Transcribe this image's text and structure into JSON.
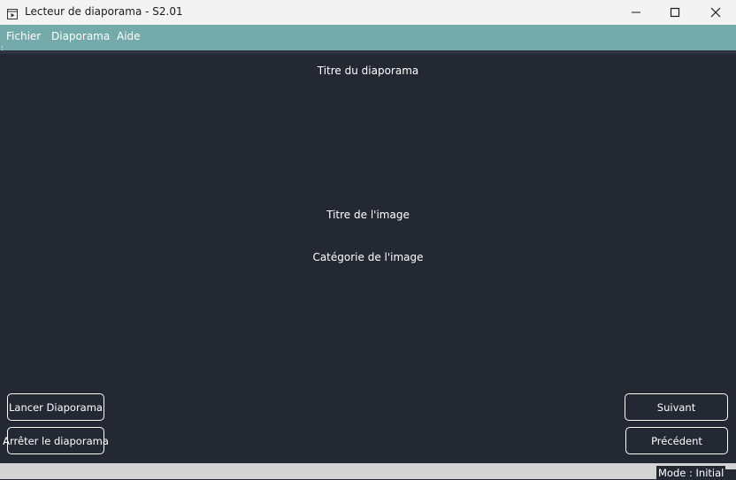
{
  "window": {
    "title": "Lecteur de diaporama - S2.01",
    "app_icon": "slideshow-icon",
    "controls": {
      "minimize_icon": "minimize-icon",
      "maximize_icon": "maximize-icon",
      "close_icon": "close-icon"
    }
  },
  "menubar": {
    "items": [
      {
        "label": "Fichier"
      },
      {
        "label": "Diaporama"
      },
      {
        "label": "Aide"
      }
    ],
    "handle": ":"
  },
  "main": {
    "slideshow_title": "Titre du diaporama",
    "image_title": "Titre de l'image",
    "image_category": "Catégorie de l'image"
  },
  "buttons": {
    "start": "Lancer Diaporama",
    "stop": "Arrêter le diaporama",
    "next": "Suivant",
    "previous": "Précédent"
  },
  "statusbar": {
    "mode": "Mode : Initial"
  },
  "colors": {
    "background": "#232833",
    "menubar": "#74aaaa",
    "titlebar": "#f3f3f3",
    "statusbar": "#d3d3d3",
    "text": "#ffffff"
  }
}
